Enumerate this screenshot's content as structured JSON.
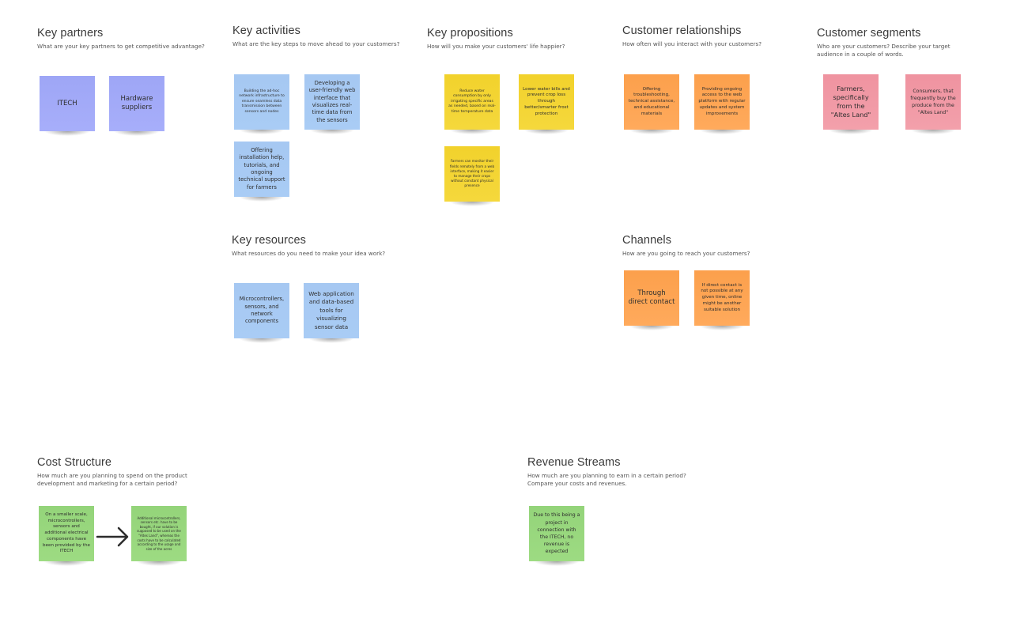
{
  "board": {
    "sections": {
      "key_partners": {
        "title": "Key partners",
        "subtitle": "What are your key partners to get competitive advantage?",
        "notes": [
          "ITECH",
          "Hardware suppliers"
        ],
        "color": "#a3abf8"
      },
      "key_activities": {
        "title": "Key activities",
        "subtitle": "What are the key steps to move ahead to your customers?",
        "notes": [
          "Building the ad-hoc network infrastructure to ensure seamless data transmission between sensors and nodes",
          "Developing a user-friendly web interface that visualizes real-time data from the sensors",
          "Offering installation help, tutorials, and ongoing technical support for farmers"
        ],
        "color": "#a8caf4"
      },
      "key_propositions": {
        "title": "Key propositions",
        "subtitle": "How will you make your customers' life happier?",
        "notes": [
          "Reduce water consumption by only irrigating specific areas as needed, based on real-time temperature data",
          "Lower water bills and prevent crop loss through better/smarter frost protection",
          "Farmers can monitor their fields remotely from a web interface, making it easier to manage their crops without constant physical presence"
        ],
        "color": "#f4d534"
      },
      "customer_relationships": {
        "title": "Customer relationships",
        "subtitle": "How often will you interact with your customers?",
        "notes": [
          "Offering troubleshooting, technical assistance, and educational materials",
          "Providing ongoing access to the web platform with regular updates and system improvements"
        ],
        "color": "#fda554"
      },
      "customer_segments": {
        "title": "Customer segments",
        "subtitle": "Who are your customers? Describe your target audience in a couple of words.",
        "notes": [
          "Farmers, specifically from the \"Altes Land\"",
          "Consumers, that frequently buy the produce from the \"Altes Land\""
        ],
        "color": "#f199a6"
      },
      "key_resources": {
        "title": "Key resources",
        "subtitle": "What resources do you need to make your idea work?",
        "notes": [
          "Microcontrollers, sensors, and network components",
          "Web application and data-based tools for visualizing sensor data"
        ],
        "color": "#a8caf4"
      },
      "channels": {
        "title": "Channels",
        "subtitle": "How are you going to reach your customers?",
        "notes": [
          "Through direct contact",
          "If direct contact is not possible at any given time, online might be another suitable solution"
        ],
        "color": "#fda554"
      },
      "cost_structure": {
        "title": "Cost Structure",
        "subtitle": "How much are you planning to spend on the product development and marketing for a certain period?",
        "notes": [
          "On a smaller scale, microcontrollers, sensors and additional electrical components have been provided by the ITECH",
          "Additional microcontrollers, sensors etc. have to be bought, if our solution is supposed to be used on the \"Altes Land\", whereas the costs have to be calculated according to the usage and size of the acres"
        ],
        "connector_icon": "arrow-right-icon",
        "color": "#98d77e"
      },
      "revenue_streams": {
        "title": "Revenue Streams",
        "subtitle": "How much are you planning to earn in a certain period? Compare your costs and revenues.",
        "notes": [
          "Due to this being a project in connection with the ITECH, no revenue is expected"
        ],
        "color": "#98d77e"
      }
    }
  }
}
